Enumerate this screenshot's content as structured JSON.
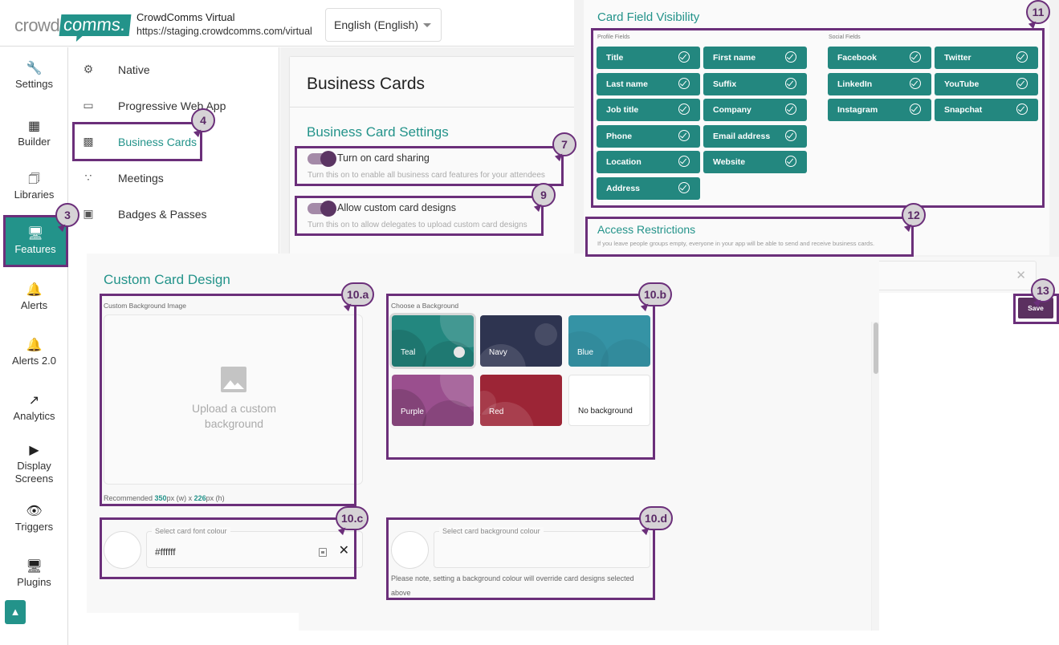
{
  "header": {
    "logo_left": "crowd",
    "logo_right": "comms.",
    "app_name": "CrowdComms Virtual",
    "app_url": "https://staging.crowdcomms.com/virtual",
    "language_selected": "English (English)"
  },
  "leftnav": {
    "items": [
      {
        "label": "Settings",
        "icon": "wrench-icon"
      },
      {
        "label": "Builder",
        "icon": "grid-icon"
      },
      {
        "label": "Libraries",
        "icon": "library-icon"
      },
      {
        "label": "Features",
        "icon": "features-icon",
        "active": true
      },
      {
        "label": "Alerts",
        "icon": "bell-icon"
      },
      {
        "label": "Alerts 2.0",
        "icon": "bell-icon"
      },
      {
        "label": "Analytics",
        "icon": "trending-up-icon"
      },
      {
        "label": "Display Screens",
        "icon": "display-screen-icon"
      },
      {
        "label": "Triggers",
        "icon": "eye-icon"
      },
      {
        "label": "Plugins",
        "icon": "plugins-icon"
      }
    ],
    "lab_button_icon": "flask-icon"
  },
  "subnav": {
    "items": [
      {
        "label": "Native",
        "icon": "mobile-settings-icon"
      },
      {
        "label": "Progressive Web App",
        "icon": "devices-icon"
      },
      {
        "label": "Business Cards",
        "icon": "business-card-icon",
        "active": true
      },
      {
        "label": "Meetings",
        "icon": "people-icon"
      },
      {
        "label": "Badges & Passes",
        "icon": "badge-icon"
      }
    ]
  },
  "business_cards": {
    "title": "Business Cards",
    "settings_title": "Business Card Settings",
    "toggles": [
      {
        "label": "Turn on card sharing",
        "help": "Turn this on to enable all business card features for your attendees",
        "on": true
      },
      {
        "label": "Allow custom card designs",
        "help": "Turn this on to allow delegates to upload custom card designs",
        "on": true
      }
    ]
  },
  "card_field_visibility": {
    "title": "Card Field Visibility",
    "profile_label": "Profile Fields",
    "social_label": "Social Fields",
    "profile_fields": [
      "Title",
      "First name",
      "Last name",
      "Suffix",
      "Job title",
      "Company",
      "Phone",
      "Email address",
      "Location",
      "Website",
      "Address"
    ],
    "social_fields": [
      "Facebook",
      "Twitter",
      "LinkedIn",
      "YouTube",
      "Instagram",
      "Snapchat"
    ]
  },
  "access_restrictions": {
    "title": "Access Restrictions",
    "help": "If you leave people groups empty, everyone in your app will be able to send and receive business cards.",
    "clear_icon": "close-icon"
  },
  "save_label": "Save",
  "custom_card_design": {
    "title": "Custom Card Design",
    "bg_image_label": "Custom Background Image",
    "upload_text": "Upload a custom background",
    "recommended_prefix": "Recommended ",
    "rec_width": "350",
    "rec_w_suffix": "px (w) x ",
    "rec_height": "226",
    "rec_h_suffix": "px (h)",
    "choose_bg_label": "Choose a Background",
    "backgrounds": [
      {
        "label": "Teal",
        "color": "#23877f",
        "selected": true
      },
      {
        "label": "Navy",
        "color": "#2e3450"
      },
      {
        "label": "Blue",
        "color": "#3593a5"
      },
      {
        "label": "Purple",
        "color": "#9a4f8e"
      },
      {
        "label": "Red",
        "color": "#9c2536"
      },
      {
        "label": "No background",
        "color": "#ffffff"
      }
    ],
    "font_colour": {
      "legend": "Select card font colour",
      "value": "#ffffff"
    },
    "bg_colour": {
      "legend": "Select card background colour",
      "value": ""
    },
    "bg_colour_note": "Please note, setting a background colour will override card designs selected above"
  },
  "annotations": [
    "3",
    "4",
    "7",
    "9",
    "11",
    "12",
    "13",
    "10.a",
    "10.b",
    "10.c",
    "10.d"
  ],
  "colors": {
    "accent": "#23938a",
    "annotation": "#6b2f7a",
    "save": "#5b3060"
  }
}
